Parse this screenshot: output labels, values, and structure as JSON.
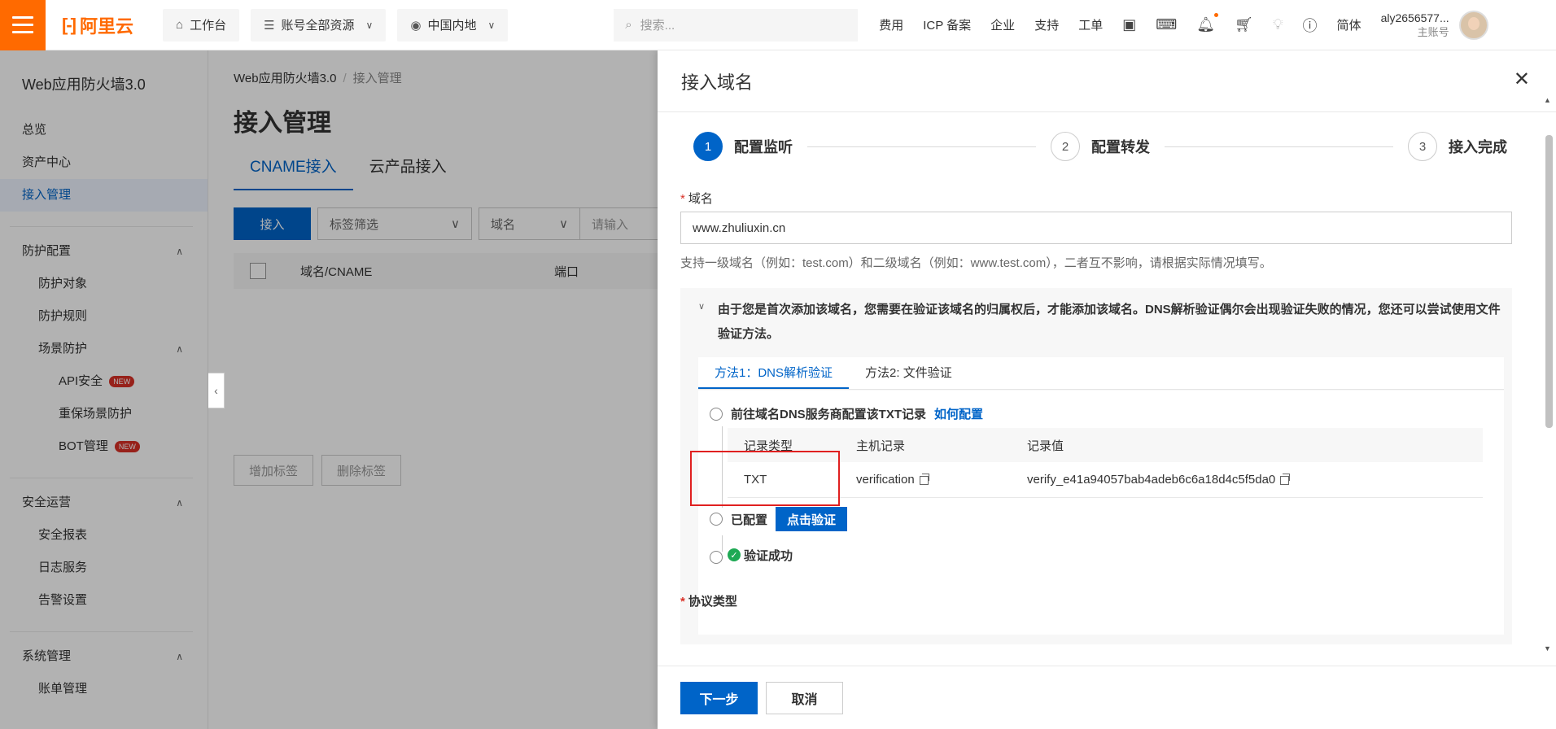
{
  "topbar": {
    "logo_text": "阿里云",
    "workbench": "工作台",
    "resources": "账号全部资源",
    "region": "中国内地",
    "search_placeholder": "搜索...",
    "links": [
      "费用",
      "ICP 备案",
      "企业",
      "支持",
      "工单"
    ],
    "lang": "简体",
    "user_name": "aly2656577...",
    "user_role": "主账号",
    "brand_color": "#ff6a00"
  },
  "sidebar": {
    "title": "Web应用防火墙3.0",
    "top_items": [
      "总览",
      "资产中心",
      "接入管理"
    ],
    "active_item": "接入管理",
    "group1": {
      "label": "防护配置",
      "items": [
        "防护对象",
        "防护规则"
      ],
      "subgroup": {
        "label": "场景防护",
        "items": [
          {
            "label": "API安全",
            "badge": "NEW"
          },
          {
            "label": "重保场景防护",
            "badge": ""
          },
          {
            "label": "BOT管理",
            "badge": "NEW"
          }
        ]
      }
    },
    "group2": {
      "label": "安全运营",
      "items": [
        "安全报表",
        "日志服务",
        "告警设置"
      ]
    },
    "group3": {
      "label": "系统管理",
      "items": [
        "账单管理"
      ]
    }
  },
  "main": {
    "breadcrumb": [
      "Web应用防火墙3.0",
      "接入管理"
    ],
    "title": "接入管理",
    "tabs": [
      "CNAME接入",
      "云产品接入"
    ],
    "access_button": "接入",
    "tag_filter": "标签筛选",
    "domain_select": "域名",
    "input_placeholder": "请输入",
    "table_headers": [
      "域名/CNAME",
      "端口"
    ],
    "add_tag": "增加标签",
    "delete_tag": "删除标签"
  },
  "drawer": {
    "title": "接入域名",
    "steps": [
      {
        "num": "1",
        "label": "配置监听",
        "active": true
      },
      {
        "num": "2",
        "label": "配置转发",
        "active": false
      },
      {
        "num": "3",
        "label": "接入完成",
        "active": false
      }
    ],
    "domain_label": "域名",
    "domain_value": "www.zhuliuxin.cn",
    "domain_hint": "支持一级域名（例如：test.com）和二级域名（例如：www.test.com），二者互不影响，请根据实际情况填写。",
    "notice": "由于您是首次添加该域名，您需要在验证该域名的归属权后，才能添加该域名。DNS解析验证偶尔会出现验证失败的情况，您还可以尝试使用文件验证方法。",
    "method_tabs": [
      "方法1：DNS解析验证",
      "方法2: 文件验证"
    ],
    "step1_text": "前往域名DNS服务商配置该TXT记录",
    "step1_link": "如何配置",
    "record_headers": [
      "记录类型",
      "主机记录",
      "记录值"
    ],
    "record": {
      "type": "TXT",
      "host": "verification",
      "value": "verify_e41a94057bab4adeb6c6a18d4c5f5da0"
    },
    "configured_text": "已配置",
    "verify_button": "点击验证",
    "success_text": "验证成功",
    "next_section": "协议类型",
    "next_button": "下一步",
    "cancel_button": "取消"
  }
}
